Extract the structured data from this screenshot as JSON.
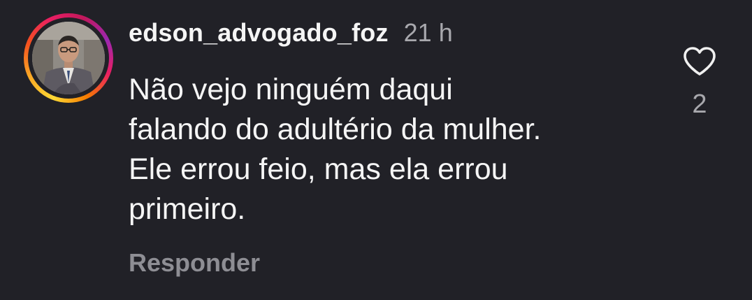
{
  "comment": {
    "username": "edson_advogado_foz",
    "time": "21 h",
    "lines": [
      "Não vejo ninguém daqui",
      "falando do adultério da mulher.",
      "Ele errou feio, mas ela errou",
      "primeiro."
    ],
    "reply_label": "Responder",
    "like_count": "2",
    "like_icon": "heart-outline-icon"
  },
  "colors": {
    "background": "#212127",
    "text": "#f5f5f5",
    "muted": "#a8a8ad",
    "reply": "#8e8e94"
  }
}
